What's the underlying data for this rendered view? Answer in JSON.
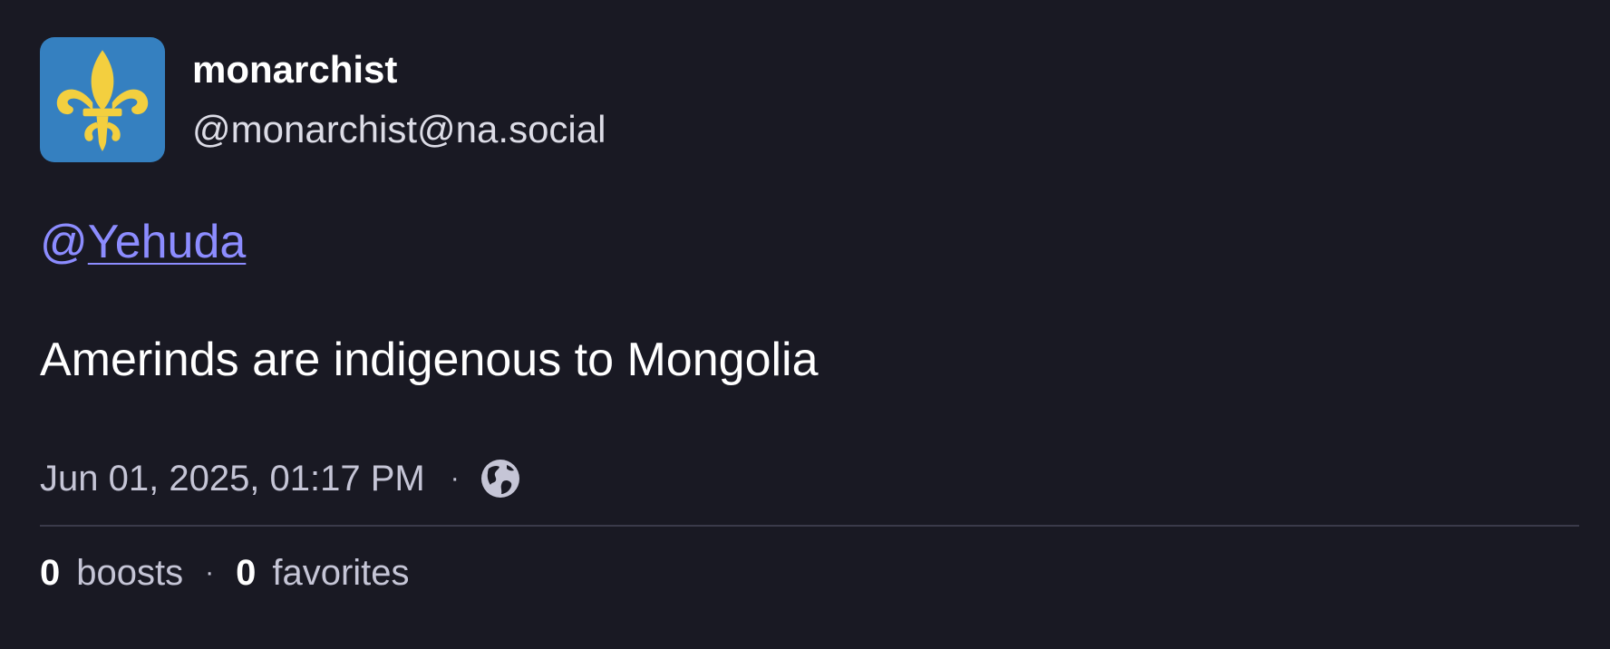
{
  "author": {
    "display_name": "monarchist",
    "handle": "@monarchist@na.social",
    "avatar_icon": "fleur-de-lis-icon",
    "avatar_bg": "#3580c0",
    "avatar_fg": "#f3cf3f"
  },
  "post": {
    "mention_prefix": "@",
    "mention_user": "Yehuda",
    "text": "Amerinds are indigenous to Mongolia",
    "timestamp": "Jun 01, 2025, 01:17 PM",
    "separator": "·",
    "visibility_icon": "globe-icon"
  },
  "stats": {
    "boosts_count": "0",
    "boosts_label": "boosts",
    "favorites_count": "0",
    "favorites_label": "favorites",
    "separator": "·"
  },
  "colors": {
    "background": "#191923",
    "mention": "#8c8cff",
    "muted_text": "#c5c5d6"
  }
}
